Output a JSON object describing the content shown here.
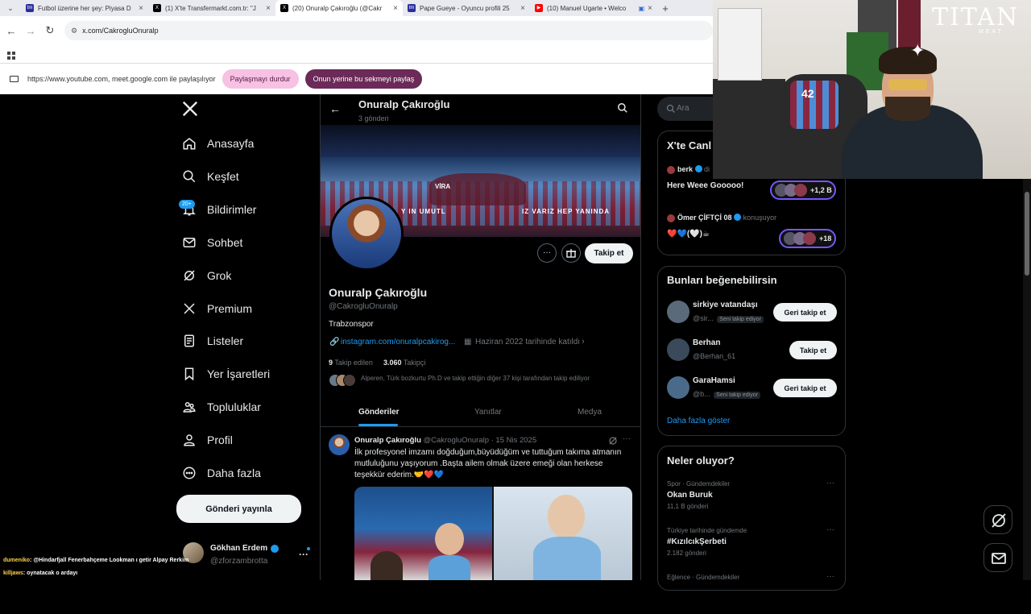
{
  "browser": {
    "tabs": [
      {
        "title": "Futbol üzerine her şey: Piyasa D",
        "fav_color": "#2b2f9b",
        "fav_text": "tm"
      },
      {
        "title": "(1) X'te Transfermarkt.com.tr: \"J",
        "fav_color": "#000000",
        "fav_text": "X"
      },
      {
        "title": "(20) Onuralp Çakıroğlu (@Cakr",
        "fav_color": "#000000",
        "fav_text": "X"
      },
      {
        "title": "Pape Gueye - Oyuncu profili 25",
        "fav_color": "#2b2f9b",
        "fav_text": "tm"
      },
      {
        "title": "(10) Manuel Ugarte • Welco",
        "fav_color": "#ff0000",
        "fav_text": "▶"
      }
    ],
    "url": "x.com/CakrogluOnuralp",
    "share_text": "https://www.youtube.com, meet.google.com ile paylaşılıyor",
    "stop_sharing": "Paylaşmayı durdur",
    "share_this_tab": "Onun yerine bu sekmeyi paylaş"
  },
  "sidebar": {
    "items": [
      {
        "label": "Anasayfa",
        "icon": "home-icon"
      },
      {
        "label": "Keşfet",
        "icon": "search-icon"
      },
      {
        "label": "Bildirimler",
        "icon": "bell-icon",
        "badge": "20+"
      },
      {
        "label": "Sohbet",
        "icon": "mail-icon"
      },
      {
        "label": "Grok",
        "icon": "grok-icon"
      },
      {
        "label": "Premium",
        "icon": "x-logo-icon"
      },
      {
        "label": "Listeler",
        "icon": "list-icon"
      },
      {
        "label": "Yer İşaretleri",
        "icon": "bookmark-icon"
      },
      {
        "label": "Topluluklar",
        "icon": "communities-icon"
      },
      {
        "label": "Profil",
        "icon": "person-icon"
      },
      {
        "label": "Daha fazla",
        "icon": "more-circle-icon"
      }
    ],
    "post_button": "Gönderi yayınla",
    "account_name": "Gökhan Erdem",
    "account_handle": "@zforzambrotta"
  },
  "profile": {
    "header_name": "Onuralp Çakıroğlu",
    "posts_count": "3 gönderi",
    "banner_text_1": "VİRA",
    "banner_text_2": "Y    IN UMUTL",
    "banner_text_3": "IZ VARIZ HEP YANINDA",
    "name": "Onuralp Çakıroğlu",
    "handle": "@CakrogluOnuralp",
    "bio": "Trabzonspor",
    "link": "instagram.com/onuralpcakirog...",
    "joined": "Haziran 2022 tarihinde katıldı",
    "following_count": "9",
    "following_label": "Takip edilen",
    "followers_count": "3.060",
    "followers_label": "Takipçi",
    "followed_by": "Alperen, Türk bozkurtu Ph.D ve takip ettiğin diğer 37 kişi tarafından takip ediliyor",
    "follow_button": "Takip et",
    "tabs": [
      "Gönderiler",
      "Yanıtlar",
      "Medya"
    ]
  },
  "post": {
    "name": "Onuralp Çakıroğlu",
    "handle": "@CakrogluOnuralp",
    "date": "· 15 Nis 2025",
    "text": "İlk profesyonel imzamı doğduğum,büyüdüğüm ve tuttuğum takıma atmanın mutluluğunu yaşıyorum .Başta ailem olmak üzere emeği olan herkese teşekkür ederim.🤝❤️💙"
  },
  "right": {
    "search_placeholder": "Ara",
    "live_title": "X'te Canlı",
    "live_items": [
      {
        "user": "berk",
        "suffix": "di",
        "text": "Here Weee Gooooo!",
        "count": "+1,2 B"
      },
      {
        "user": "Ömer ÇİFTÇİ 08",
        "suffix": "konuşuyor",
        "text": "❤️💙(🤍)☕",
        "count": "+18"
      }
    ],
    "suggest_title": "Bunları beğenebilirsin",
    "suggestions": [
      {
        "name": "sirkiye vatandaşı",
        "handle": "@sir...",
        "badge": "Seni takip ediyor",
        "button": "Geri takip et"
      },
      {
        "name": "Berhan",
        "handle": "@Berhan_61",
        "badge": "",
        "button": "Takip et"
      },
      {
        "name": "GaraHamsi",
        "handle": "@b...",
        "badge": "Seni takip ediyor",
        "button": "Geri takip et"
      }
    ],
    "show_more": "Daha fazla göster",
    "trends_title": "Neler oluyor?",
    "trends": [
      {
        "context": "Spor · Gündemdekiler",
        "title": "Okan Buruk",
        "count": "11,1 B gönderi"
      },
      {
        "context": "Türkiye tarihinde gündemde",
        "title": "#KızılcıkŞerbeti",
        "count": "2.182 gönderi"
      },
      {
        "context": "Eğlence · Gündemdekiler",
        "title": "",
        "count": ""
      }
    ]
  },
  "stream": {
    "logo_text": "TITAN",
    "logo_sub": "MEAT",
    "chat": [
      {
        "user": "dumeniko",
        "text": ": @Hindarfjall Fenerbahçeme Lookman ı getir Alpay Rerkim"
      },
      {
        "user": "killjaws",
        "text": ": oynatacak o ardayı"
      }
    ],
    "jersey_number": "42"
  }
}
